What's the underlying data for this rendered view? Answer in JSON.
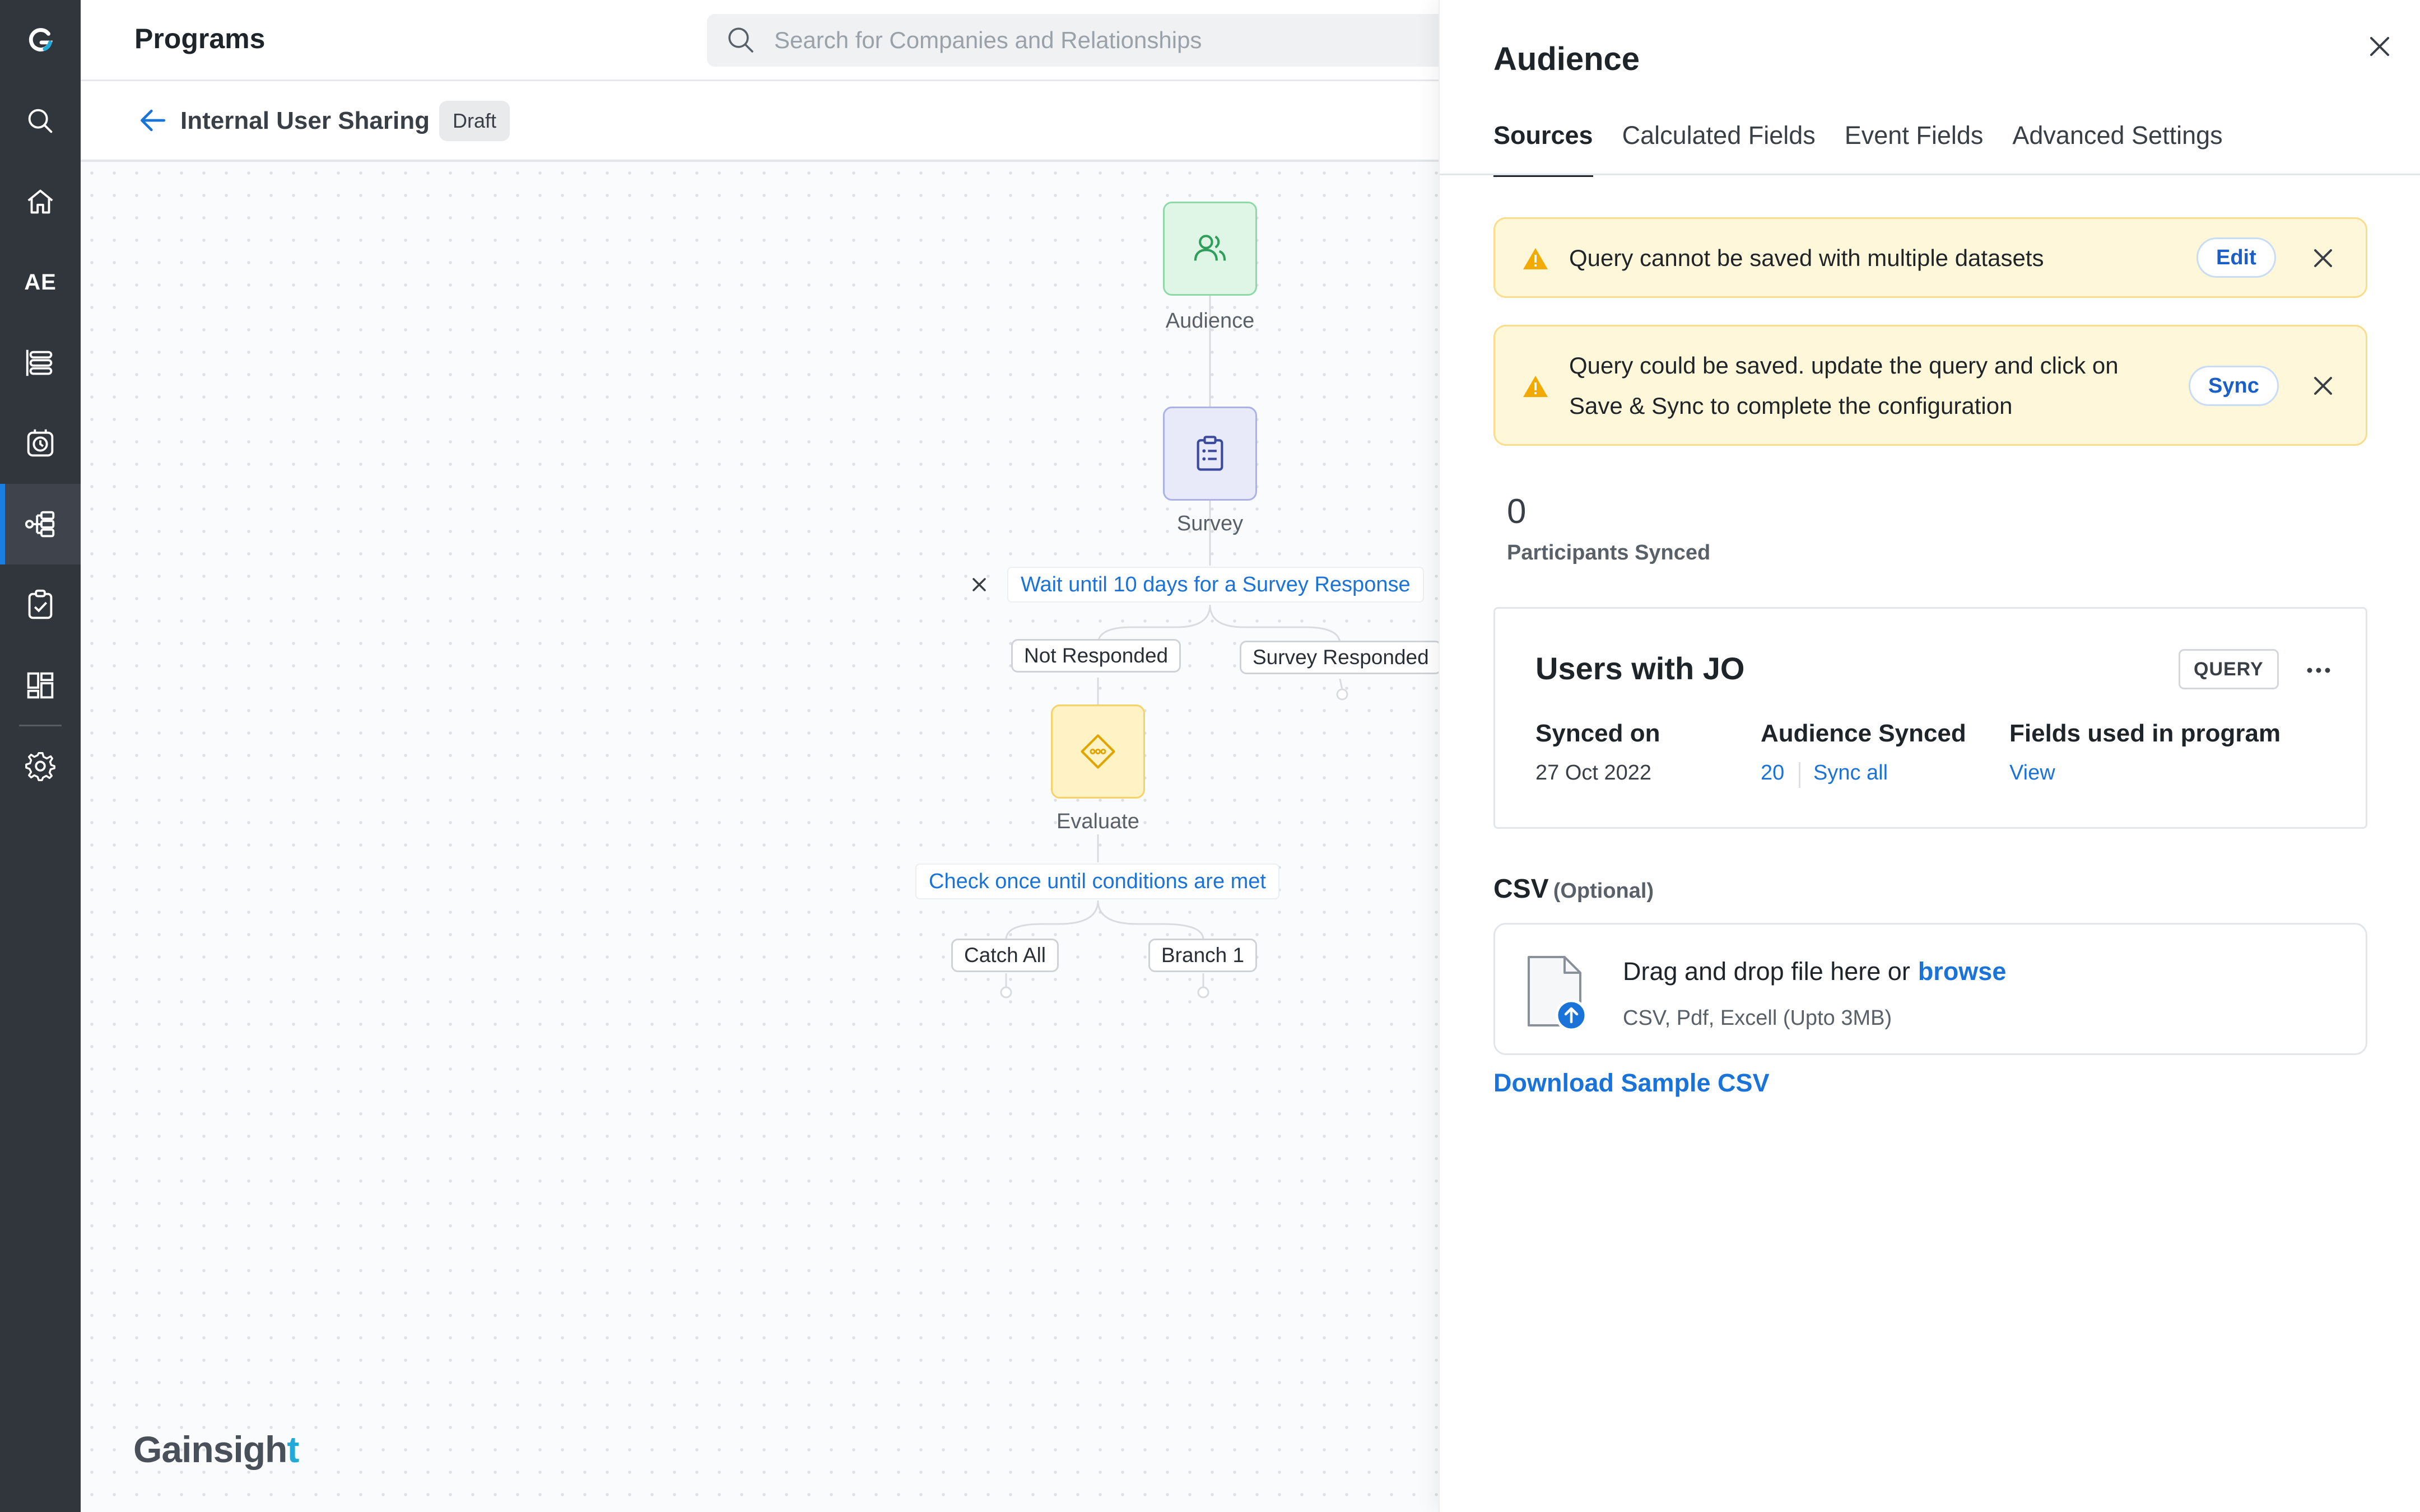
{
  "app": {
    "title": "Programs"
  },
  "colors": {
    "accent": "#1a73d9",
    "nav_bg": "#31353c",
    "warning_bg": "#fff7d9",
    "audience_node": "#dff5e6",
    "survey_node": "#e8eafa",
    "evaluate_node": "#fff3c6"
  },
  "sidenav": {
    "items": [
      {
        "icon": "gainsight-logo-icon"
      },
      {
        "icon": "search-icon"
      },
      {
        "icon": "home-icon"
      },
      {
        "label": "AE"
      },
      {
        "icon": "timeline-icon"
      },
      {
        "icon": "clock-icon"
      },
      {
        "icon": "journey-orchestrator-icon",
        "active": true
      },
      {
        "icon": "checklist-icon"
      },
      {
        "icon": "dashboard-icon"
      },
      {
        "icon": "gear-icon"
      }
    ]
  },
  "search": {
    "placeholder": "Search for Companies and Relationships"
  },
  "program": {
    "name": "Internal User Sharing",
    "status": "Draft"
  },
  "flow": {
    "nodes": {
      "audience": "Audience",
      "survey": "Survey",
      "evaluate": "Evaluate"
    },
    "survey_condition": "Wait until 10 days for a Survey Response",
    "survey_branches": [
      "Not Responded",
      "Survey Responded"
    ],
    "evaluate_condition": "Check once until conditions are met",
    "evaluate_branches": [
      "Catch All",
      "Branch 1"
    ]
  },
  "brand": {
    "name_main": "Gainsigh",
    "name_accent": "t"
  },
  "panel": {
    "title": "Audience",
    "tabs": [
      "Sources",
      "Calculated Fields",
      "Event Fields",
      "Advanced Settings"
    ],
    "active_tab": "Sources",
    "alerts": [
      {
        "message": "Query cannot be saved with multiple datasets",
        "action": "Edit"
      },
      {
        "message_line1": "Query could be saved. update the query and click on",
        "message_line2": "Save & Sync to complete the configuration",
        "action": "Sync"
      }
    ],
    "participants": {
      "count": "0",
      "label": "Participants Synced"
    },
    "source": {
      "title": "Users with JO",
      "badge": "QUERY",
      "columns": [
        {
          "header": "Synced on",
          "value": "27 Oct 2022"
        },
        {
          "header": "Audience Synced",
          "value": "20",
          "link": "Sync all"
        },
        {
          "header": "Fields used in program",
          "link": "View"
        }
      ]
    },
    "csv": {
      "title": "CSV",
      "optional": "(Optional)",
      "drop_text": "Drag and drop file here or",
      "browse": "browse",
      "hint": "CSV, Pdf, Excell (Upto 3MB)",
      "download": "Download Sample CSV"
    }
  }
}
